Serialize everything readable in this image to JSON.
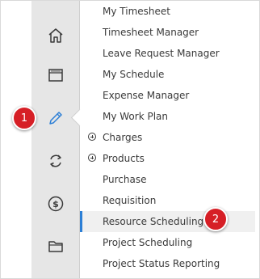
{
  "rail": {
    "items": [
      {
        "icon": "home-icon"
      },
      {
        "icon": "window-icon"
      },
      {
        "icon": "pencil-icon",
        "active": true
      },
      {
        "icon": "refresh-icon"
      },
      {
        "icon": "dollar-icon"
      },
      {
        "icon": "folder-icon"
      }
    ]
  },
  "menu": {
    "items": [
      {
        "label": "My Timesheet"
      },
      {
        "label": "Timesheet Manager"
      },
      {
        "label": "Leave Request Manager"
      },
      {
        "label": "My Schedule"
      },
      {
        "label": "Expense Manager"
      },
      {
        "label": "My Work Plan"
      },
      {
        "label": "Charges",
        "expandable": true
      },
      {
        "label": "Products",
        "expandable": true
      },
      {
        "label": "Purchase"
      },
      {
        "label": "Requisition"
      },
      {
        "label": "Resource Scheduling",
        "active": true
      },
      {
        "label": "Project Scheduling"
      },
      {
        "label": "Project Status Reporting"
      }
    ]
  },
  "callouts": {
    "step1": "1",
    "step2": "2"
  },
  "colors": {
    "accent": "#2c7fd6",
    "badge": "#d61f26",
    "rail_bg": "#e6e6e6",
    "active_item_bg": "#f0f0f0"
  }
}
